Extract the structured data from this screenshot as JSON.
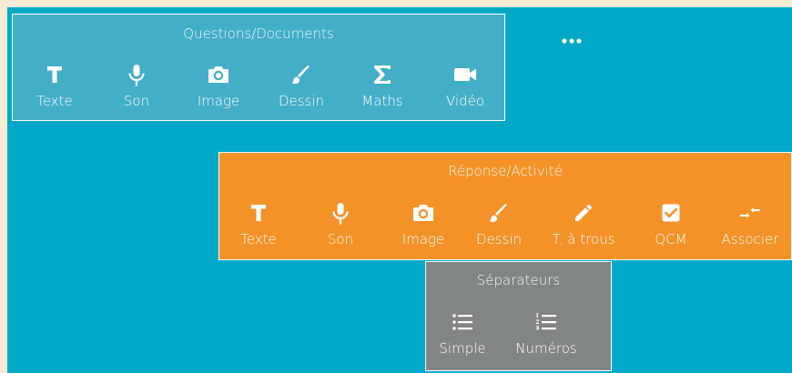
{
  "questions_panel": {
    "title": "Questions/Documents",
    "tools": [
      {
        "label": "Texte",
        "icon": "text-icon"
      },
      {
        "label": "Son",
        "icon": "microphone-icon"
      },
      {
        "label": "Image",
        "icon": "camera-icon"
      },
      {
        "label": "Dessin",
        "icon": "brush-icon"
      },
      {
        "label": "Maths",
        "icon": "sigma-icon"
      },
      {
        "label": "Vidéo",
        "icon": "video-camera-icon"
      }
    ]
  },
  "response_panel": {
    "title": "Réponse/Activité",
    "tools": [
      {
        "label": "Texte",
        "icon": "text-icon"
      },
      {
        "label": "Son",
        "icon": "microphone-icon"
      },
      {
        "label": "Image",
        "icon": "camera-icon"
      },
      {
        "label": "Dessin",
        "icon": "brush-icon"
      },
      {
        "label": "T. à trous",
        "icon": "pencil-icon"
      },
      {
        "label": "QCM",
        "icon": "checkbox-icon"
      },
      {
        "label": "Associer",
        "icon": "arrows-join-icon"
      }
    ]
  },
  "separators_panel": {
    "title": "Séparateurs",
    "tools": [
      {
        "label": "Simple",
        "icon": "bulleted-list-icon"
      },
      {
        "label": "Numéros",
        "icon": "numbered-list-icon"
      }
    ]
  },
  "colors": {
    "canvas": "#00a9c7",
    "questions_panel": "#43aec7",
    "response_panel": "#f59227",
    "separators_panel": "#828585",
    "outer_frame": "#f9ebd4"
  },
  "more_menu": {
    "icon": "more-dots-icon"
  }
}
